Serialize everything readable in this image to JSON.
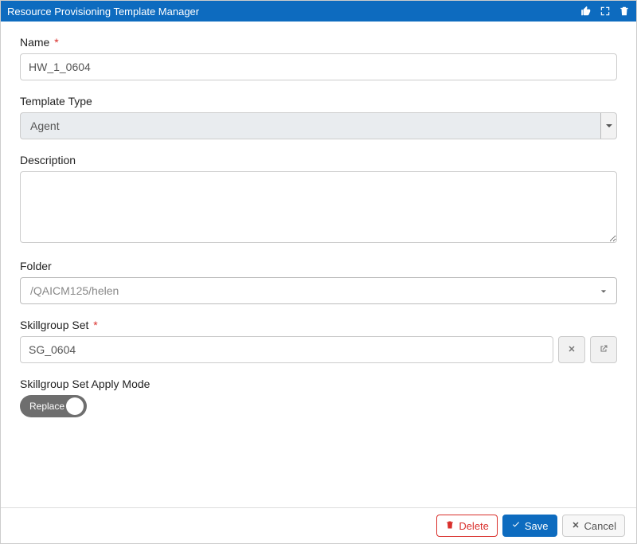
{
  "titlebar": {
    "title": "Resource Provisioning Template Manager"
  },
  "form": {
    "name": {
      "label": "Name",
      "required_marker": "*",
      "value": "HW_1_0604"
    },
    "template_type": {
      "label": "Template Type",
      "value": "Agent"
    },
    "description": {
      "label": "Description",
      "value": ""
    },
    "folder": {
      "label": "Folder",
      "value": "/QAICM125/helen"
    },
    "skillgroup_set": {
      "label": "Skillgroup Set",
      "required_marker": "*",
      "value": "SG_0604"
    },
    "apply_mode": {
      "label": "Skillgroup Set Apply Mode",
      "value": "Replace"
    }
  },
  "footer": {
    "delete": "Delete",
    "save": "Save",
    "cancel": "Cancel"
  }
}
